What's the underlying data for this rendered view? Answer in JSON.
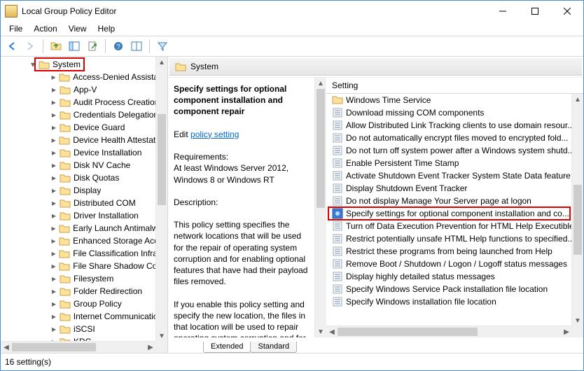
{
  "window": {
    "title": "Local Group Policy Editor"
  },
  "menubar": {
    "file": "File",
    "action": "Action",
    "view": "View",
    "help": "Help"
  },
  "toolbar": {
    "back": "back-icon",
    "forward": "forward-icon",
    "up": "up-icon",
    "show_hide_tree": "tree-icon",
    "export": "export-icon",
    "help": "help-icon",
    "details": "details-icon",
    "filter": "filter-icon"
  },
  "tree": {
    "selected_label": "System",
    "items": [
      "Access-Denied Assistan",
      "App-V",
      "Audit Process Creation",
      "Credentials Delegation",
      "Device Guard",
      "Device Health Attestatio",
      "Device Installation",
      "Disk NV Cache",
      "Disk Quotas",
      "Display",
      "Distributed COM",
      "Driver Installation",
      "Early Launch Antimalwa",
      "Enhanced Storage Acce",
      "File Classification Infras",
      "File Share Shadow Cop",
      "Filesystem",
      "Folder Redirection",
      "Group Policy",
      "Internet Communicatio",
      "iSCSI",
      "KDC"
    ]
  },
  "details": {
    "header": "System",
    "policy_title": "Specify settings for optional component installation and component repair",
    "edit_prefix": "Edit ",
    "edit_link_text": "policy setting ",
    "requirements_label": "Requirements:",
    "requirements_text": "At least Windows Server 2012, Windows 8 or Windows RT",
    "description_label": "Description:",
    "description_para1": "This policy setting specifies the network locations that will be used for the repair of operating system corruption and for enabling optional features that have had their payload files removed.",
    "description_para2": "If you enable this policy setting and specify the new location, the files in that location will be used to repair operating system corruption and for enabling"
  },
  "list": {
    "column_header": "Setting",
    "items": [
      {
        "type": "folder",
        "label": "Windows Time Service"
      },
      {
        "type": "setting",
        "label": "Download missing COM components"
      },
      {
        "type": "setting",
        "label": "Allow Distributed Link Tracking clients to use domain resour..."
      },
      {
        "type": "setting",
        "label": "Do not automatically encrypt files moved to encrypted fold..."
      },
      {
        "type": "setting",
        "label": "Do not turn off system power after a Windows system shutd..."
      },
      {
        "type": "setting",
        "label": "Enable Persistent Time Stamp"
      },
      {
        "type": "setting",
        "label": "Activate Shutdown Event Tracker System State Data feature"
      },
      {
        "type": "setting",
        "label": "Display Shutdown Event Tracker"
      },
      {
        "type": "setting",
        "label": "Do not display Manage Your Server page at logon"
      },
      {
        "type": "setting",
        "label": "Specify settings for optional component installation and co...",
        "highlighted": true
      },
      {
        "type": "setting",
        "label": "Turn off Data Execution Prevention for HTML Help Executible"
      },
      {
        "type": "setting",
        "label": "Restrict potentially unsafe HTML Help functions to specified..."
      },
      {
        "type": "setting",
        "label": "Restrict these programs from being launched from Help"
      },
      {
        "type": "setting",
        "label": "Remove Boot / Shutdown / Logon / Logoff status messages"
      },
      {
        "type": "setting",
        "label": "Display highly detailed status messages"
      },
      {
        "type": "setting",
        "label": "Specify Windows Service Pack installation file location"
      },
      {
        "type": "setting",
        "label": "Specify Windows installation file location"
      }
    ]
  },
  "tabs": {
    "extended": "Extended",
    "standard": "Standard"
  },
  "status": {
    "text": "16 setting(s)"
  }
}
